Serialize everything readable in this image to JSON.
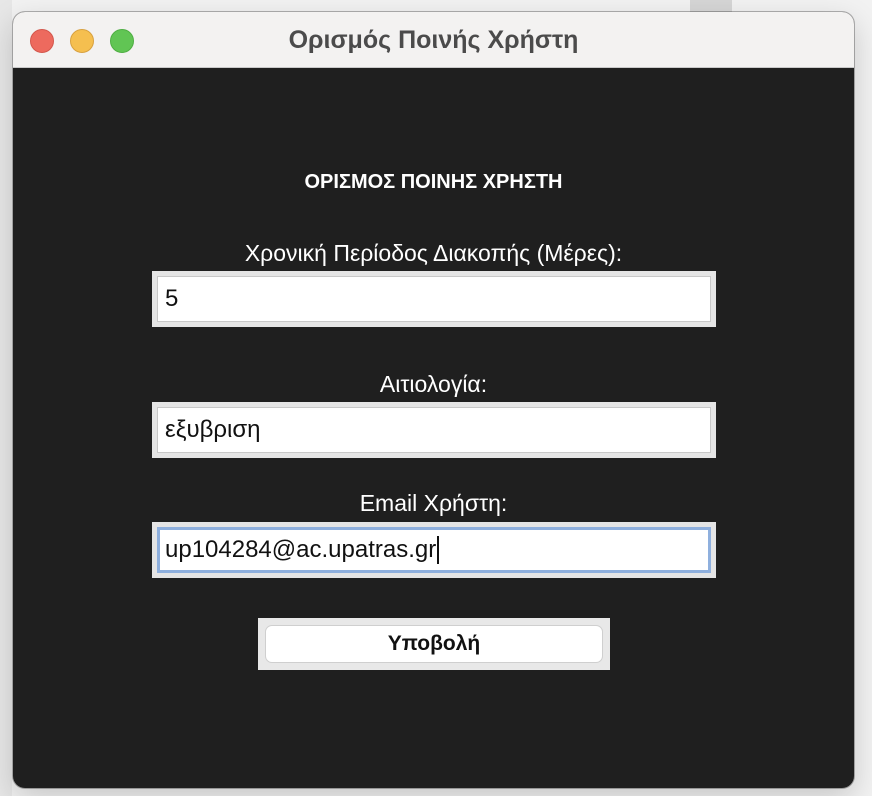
{
  "window": {
    "title": "Ορισμός Ποινής Χρήστη"
  },
  "form": {
    "heading": "ΟΡΙΣΜΟΣ ΠΟΙΝΗΣ ΧΡΗΣΤΗ",
    "period_label": "Χρονική Περίοδος Διακοπής (Μέρες):",
    "period_value": "5",
    "reason_label": "Αιτιολογία:",
    "reason_value": "εξυβριση",
    "email_label": "Email Χρήστη:",
    "email_value": "up104284@ac.upatras.gr",
    "submit_label": "Υποβολή"
  },
  "colors": {
    "background": "#1f1f1f",
    "titlebar": "#f3f2f1",
    "close": "#ed6a5e",
    "minimize": "#f5bf4f",
    "zoom": "#61c554",
    "focus_ring": "#8fb0de"
  },
  "icons": {
    "close": "close-traffic-light-icon",
    "minimize": "minimize-traffic-light-icon",
    "zoom": "zoom-traffic-light-icon"
  }
}
